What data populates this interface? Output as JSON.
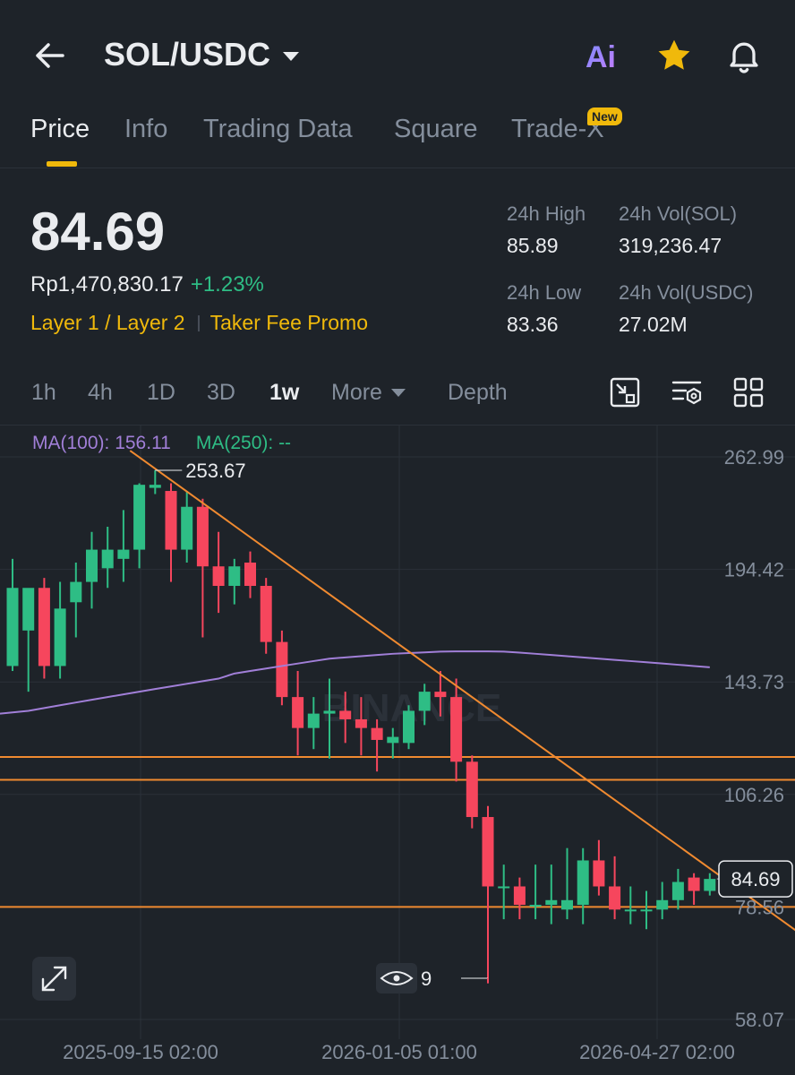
{
  "header": {
    "pair": "SOL/USDC",
    "ai_label": "Ai"
  },
  "tabs": [
    {
      "label": "Price",
      "active": true
    },
    {
      "label": "Info"
    },
    {
      "label": "Trading Data"
    },
    {
      "label": "Square"
    },
    {
      "label": "Trade-X",
      "badge": "New"
    }
  ],
  "ticker": {
    "last_price": "84.69",
    "fiat_price": "Rp1,470,830.17",
    "change_pct": "+1.23%",
    "tag_category": "Layer 1 / Layer 2",
    "tag_promo": "Taker Fee Promo",
    "high_label": "24h High",
    "high_value": "85.89",
    "low_label": "24h Low",
    "low_value": "83.36",
    "vol_base_label": "24h Vol(SOL)",
    "vol_base_value": "319,236.47",
    "vol_quote_label": "24h Vol(USDC)",
    "vol_quote_value": "27.02M"
  },
  "intervals": {
    "items": [
      "1h",
      "4h",
      "1D",
      "3D",
      "1w"
    ],
    "active": "1w",
    "more_label": "More",
    "depth_label": "Depth"
  },
  "indicators": {
    "ma100": "MA(100): 156.11",
    "ma250": "MA(250): --"
  },
  "colors": {
    "up": "#2ebd85",
    "down": "#f6465d",
    "accent": "#f0b90b",
    "ma100": "#a17fd8",
    "trendline": "#f08a30"
  },
  "chart_data": {
    "type": "candlestick",
    "watermark": "BINANCE",
    "y_axis_labels": [
      "262.99",
      "194.42",
      "143.73",
      "106.26",
      "78.56",
      "58.07"
    ],
    "x_axis_labels": [
      "2025-09-15 02:00",
      "2026-01-05 01:00",
      "2026-04-27 02:00"
    ],
    "current_price_label": "84.69",
    "high_marker": "253.67",
    "low_marker": "9",
    "ylim": [
      58.07,
      262.99
    ],
    "y_scale": "log",
    "candles": [
      {
        "o": 150,
        "h": 200,
        "l": 148,
        "c": 185
      },
      {
        "o": 165,
        "h": 175,
        "l": 140,
        "c": 185
      },
      {
        "o": 185,
        "h": 190,
        "l": 145,
        "c": 150
      },
      {
        "o": 150,
        "h": 188,
        "l": 145,
        "c": 175
      },
      {
        "o": 178,
        "h": 198,
        "l": 162,
        "c": 188
      },
      {
        "o": 188,
        "h": 215,
        "l": 175,
        "c": 205
      },
      {
        "o": 195,
        "h": 218,
        "l": 185,
        "c": 205
      },
      {
        "o": 200,
        "h": 228,
        "l": 188,
        "c": 205
      },
      {
        "o": 205,
        "h": 245,
        "l": 195,
        "c": 244
      },
      {
        "o": 242,
        "h": 253.67,
        "l": 238,
        "c": 244
      },
      {
        "o": 240,
        "h": 245,
        "l": 188,
        "c": 205
      },
      {
        "o": 205,
        "h": 240,
        "l": 198,
        "c": 230
      },
      {
        "o": 230,
        "h": 235,
        "l": 162,
        "c": 196
      },
      {
        "o": 196,
        "h": 215,
        "l": 173,
        "c": 186
      },
      {
        "o": 186,
        "h": 200,
        "l": 177,
        "c": 196
      },
      {
        "o": 198,
        "h": 204,
        "l": 180,
        "c": 186
      },
      {
        "o": 186,
        "h": 190,
        "l": 155,
        "c": 160
      },
      {
        "o": 160,
        "h": 165,
        "l": 135,
        "c": 138
      },
      {
        "o": 138,
        "h": 148,
        "l": 118,
        "c": 127
      },
      {
        "o": 127,
        "h": 138,
        "l": 120,
        "c": 132
      },
      {
        "o": 132,
        "h": 145,
        "l": 117,
        "c": 133
      },
      {
        "o": 133,
        "h": 140,
        "l": 122,
        "c": 130
      },
      {
        "o": 130,
        "h": 138,
        "l": 118,
        "c": 127
      },
      {
        "o": 127,
        "h": 130,
        "l": 113,
        "c": 123
      },
      {
        "o": 122,
        "h": 127,
        "l": 117,
        "c": 124
      },
      {
        "o": 122,
        "h": 135,
        "l": 120,
        "c": 133
      },
      {
        "o": 133,
        "h": 143,
        "l": 128,
        "c": 140
      },
      {
        "o": 140,
        "h": 148,
        "l": 131,
        "c": 138
      },
      {
        "o": 138,
        "h": 145,
        "l": 110,
        "c": 116
      },
      {
        "o": 116,
        "h": 118,
        "l": 97,
        "c": 100
      },
      {
        "o": 100,
        "h": 103,
        "l": 64,
        "c": 83
      },
      {
        "o": 83,
        "h": 88,
        "l": 76,
        "c": 83
      },
      {
        "o": 83,
        "h": 85,
        "l": 76,
        "c": 79
      },
      {
        "o": 79,
        "h": 88,
        "l": 76,
        "c": 79
      },
      {
        "o": 79,
        "h": 88,
        "l": 75,
        "c": 80
      },
      {
        "o": 78,
        "h": 92,
        "l": 76,
        "c": 80
      },
      {
        "o": 79,
        "h": 92,
        "l": 75,
        "c": 89
      },
      {
        "o": 89,
        "h": 94,
        "l": 81,
        "c": 83
      },
      {
        "o": 83,
        "h": 90,
        "l": 76,
        "c": 78
      },
      {
        "o": 78,
        "h": 83,
        "l": 75,
        "c": 78
      },
      {
        "o": 78,
        "h": 82,
        "l": 74,
        "c": 78
      },
      {
        "o": 78,
        "h": 84,
        "l": 76,
        "c": 80
      },
      {
        "o": 80,
        "h": 87,
        "l": 78,
        "c": 84
      },
      {
        "o": 85,
        "h": 86,
        "l": 79,
        "c": 82
      },
      {
        "o": 82,
        "h": 86,
        "l": 81,
        "c": 84.69
      }
    ],
    "ma100_series": [
      132,
      133,
      134,
      135,
      136,
      137,
      138,
      139,
      140,
      141,
      142,
      143,
      144,
      145,
      147,
      148,
      149,
      150,
      151,
      152,
      153,
      153.5,
      154,
      154.5,
      155,
      155.3,
      155.6,
      155.9,
      156,
      156,
      156,
      155.9,
      155.5,
      155,
      154.5,
      154,
      153.5,
      153,
      152.5,
      152,
      151.5,
      151,
      150.5,
      150,
      149.5
    ],
    "horizontal_levels": [
      117.5,
      110.5,
      78.56
    ],
    "trendline": [
      {
        "candle": 9,
        "price": 253.67
      },
      {
        "candle": 50,
        "price": 70
      }
    ]
  }
}
